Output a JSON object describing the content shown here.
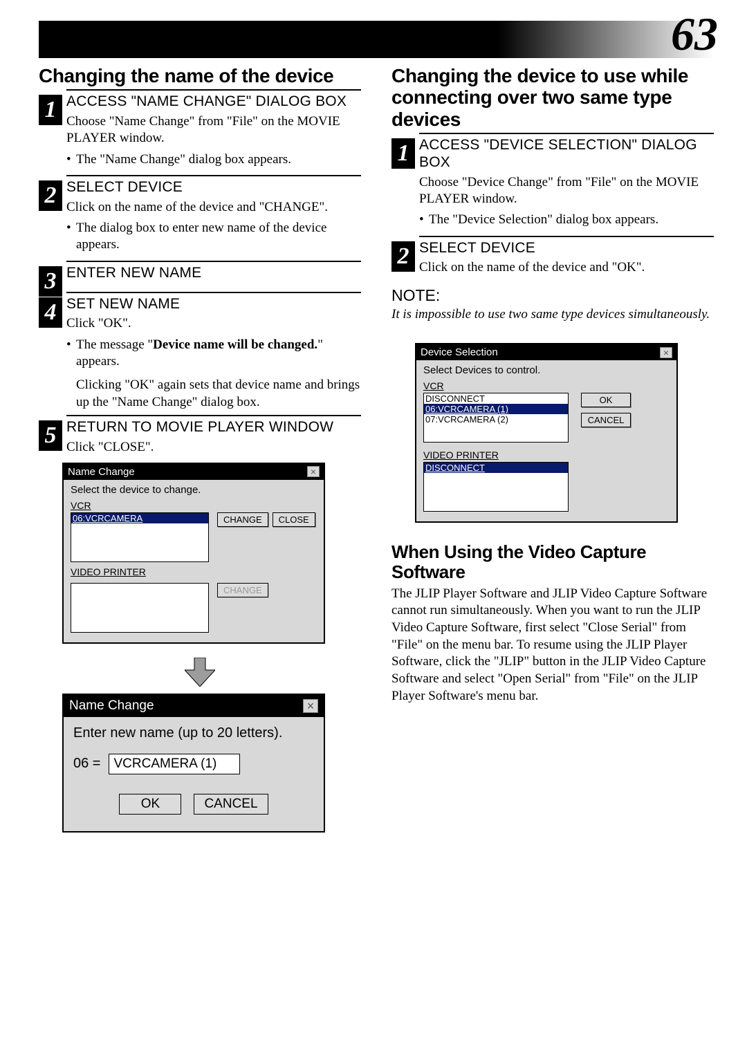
{
  "page_number": "63",
  "left": {
    "heading": "Changing the name of the device",
    "steps": [
      {
        "num": "1",
        "title": "ACCESS \"NAME CHANGE\" DIALOG BOX",
        "body": "Choose \"Name Change\" from \"File\" on the MOVIE PLAYER window.",
        "bullets": [
          "The \"Name Change\" dialog box appears."
        ]
      },
      {
        "num": "2",
        "title": "SELECT DEVICE",
        "body": "Click on the name of the device and \"CHANGE\".",
        "bullets": [
          "The dialog box to enter new name of the device appears."
        ]
      },
      {
        "num": "3",
        "title": "ENTER NEW NAME",
        "body": "",
        "bullets": []
      },
      {
        "num": "4",
        "title": "SET NEW NAME",
        "body": "Click \"OK\".",
        "bullets": [
          "The message \"Device name will be changed.\" appears."
        ],
        "extra": "Clicking \"OK\" again sets that device name and brings up the \"Name Change\" dialog box."
      },
      {
        "num": "5",
        "title": "RETURN TO MOVIE PLAYER WINDOW",
        "body": "Click \"CLOSE\".",
        "bullets": []
      }
    ],
    "dlg1": {
      "title": "Name Change",
      "instr": "Select the device to change.",
      "vcr_label": "VCR",
      "vcr_item": "06:VCRCAMERA",
      "vp_label": "VIDEO PRINTER",
      "btn_change": "CHANGE",
      "btn_close": "CLOSE",
      "btn_change2": "CHANGE"
    },
    "dlg2": {
      "title": "Name Change",
      "instr": "Enter new name (up to 20 letters).",
      "prefix": "06  =",
      "value": "VCRCAMERA (1)",
      "ok": "OK",
      "cancel": "CANCEL"
    }
  },
  "right": {
    "heading": "Changing the device to use while connecting over two same type devices",
    "steps": [
      {
        "num": "1",
        "title": "ACCESS \"DEVICE SELECTION\" DIALOG BOX",
        "body": "Choose \"Device Change\" from \"File\" on the MOVIE PLAYER window.",
        "bullets": [
          "The \"Device Selection\" dialog box appears."
        ]
      },
      {
        "num": "2",
        "title": "SELECT DEVICE",
        "body": "Click on the name of the device and \"OK\".",
        "bullets": []
      }
    ],
    "note_label": "NOTE:",
    "note_body": "It is impossible to use two same type devices simultaneously.",
    "dlg": {
      "title": "Device Selection",
      "instr": "Select Devices to control.",
      "vcr_label": "VCR",
      "vcr_items": [
        "DISCONNECT",
        "06:VCRCAMERA (1)",
        "07:VCRCAMERA (2)"
      ],
      "vp_label": "VIDEO PRINTER",
      "vp_items": [
        "DISCONNECT"
      ],
      "ok": "OK",
      "cancel": "CANCEL"
    },
    "heading2": "When Using the Video Capture Software",
    "para": "The JLIP Player Software and JLIP Video Capture Software cannot run simultaneously. When you want to run the JLIP Video Capture Software, first select \"Close Serial\" from \"File\" on the menu bar.  To resume using the JLIP Player Software, click the \"JLIP\" button in the JLIP Video Capture Software and select \"Open Serial\" from \"File\" on the JLIP Player Software's menu bar."
  }
}
